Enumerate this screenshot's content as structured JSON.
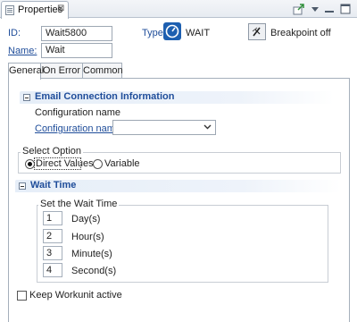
{
  "view": {
    "tab_label": "Properties",
    "tab_close": "⊠",
    "toolbar": [
      "export-icon",
      "view-menu-icon",
      "minimize-icon",
      "maximize-icon"
    ]
  },
  "header": {
    "id_label": "ID:",
    "id_value": "Wait5800",
    "type_label": "Type:",
    "type_value": "WAIT",
    "breakpoint_label": "Breakpoint off",
    "name_label": "Name:",
    "name_value": "Wait"
  },
  "tabs": [
    {
      "label": "General"
    },
    {
      "label": "On Error"
    },
    {
      "label": "Common"
    }
  ],
  "email_section": {
    "title": "Email Connection Information",
    "config_heading": "Configuration name",
    "config_label": "Configuration name:",
    "config_value": ""
  },
  "select_option": {
    "legend": "Select Option",
    "options": [
      {
        "label": "Direct Values",
        "checked": true
      },
      {
        "label": "Variable",
        "checked": false
      }
    ]
  },
  "wait_section": {
    "title": "Wait Time",
    "group_legend": "Set the Wait Time",
    "rows": [
      {
        "value": "1",
        "unit": "Day(s)"
      },
      {
        "value": "2",
        "unit": "Hour(s)"
      },
      {
        "value": "3",
        "unit": "Minute(s)"
      },
      {
        "value": "4",
        "unit": "Second(s)"
      }
    ]
  },
  "keep_workunit": {
    "label": "Keep Workunit active",
    "checked": false
  },
  "colors": {
    "accent": "#1f4d9a",
    "section_bar": "#e6eef8"
  }
}
